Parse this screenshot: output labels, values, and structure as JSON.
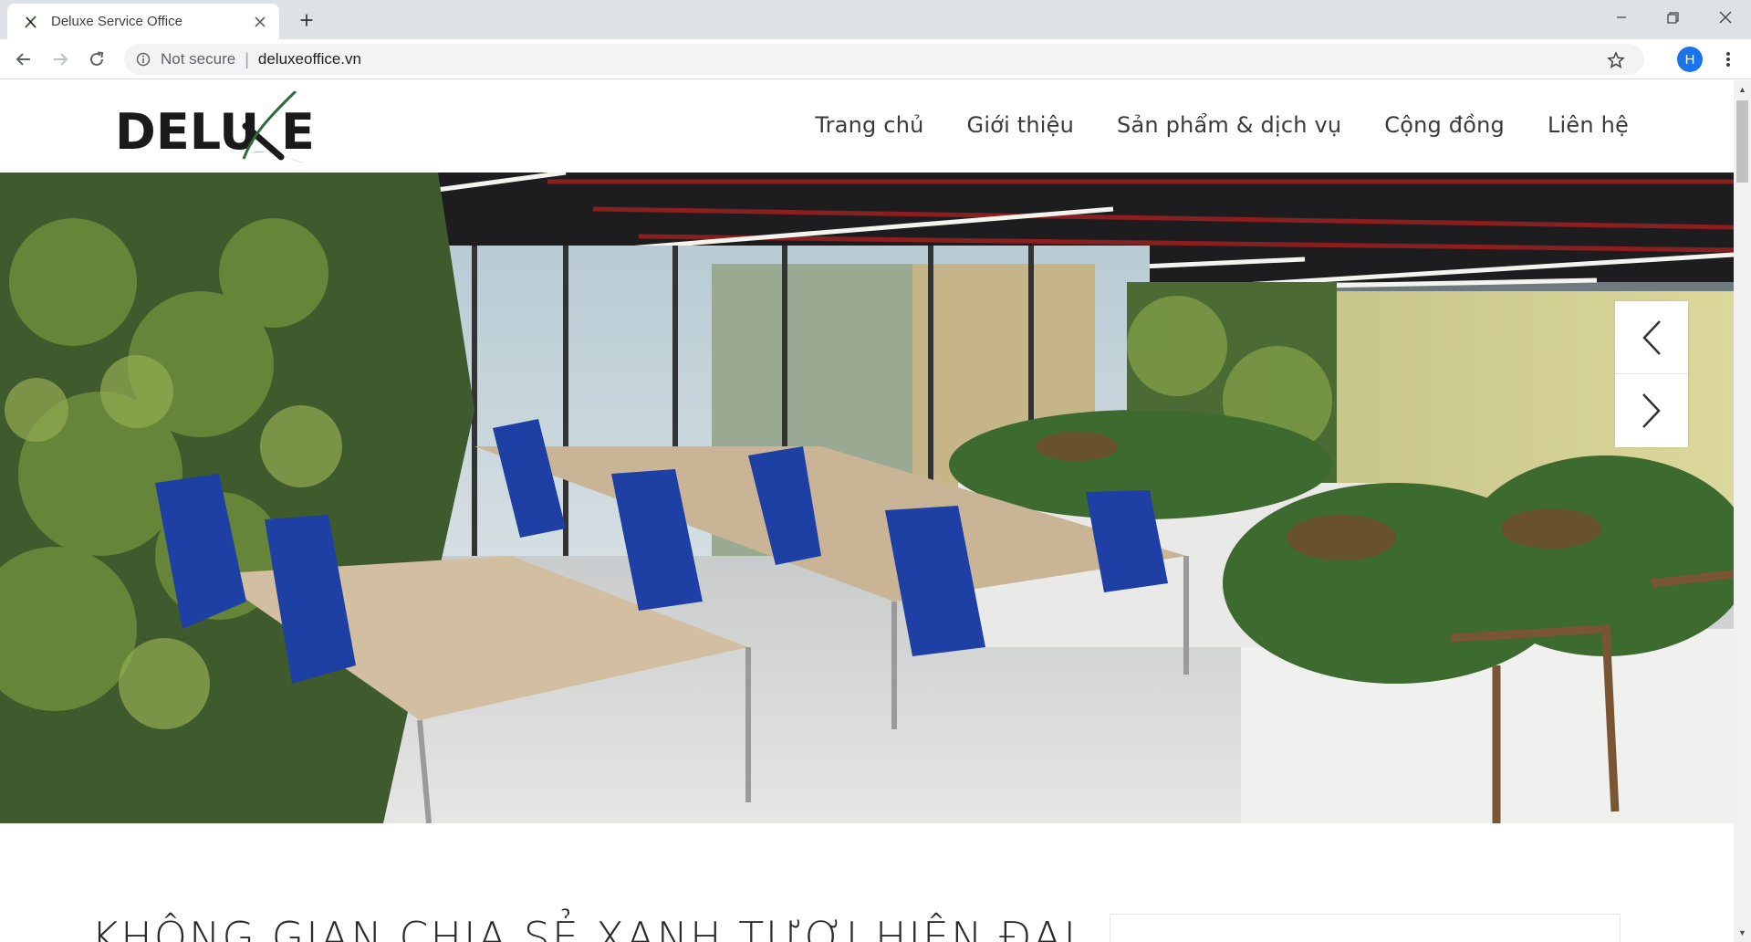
{
  "browser": {
    "tab_title": "Deluxe Service Office",
    "new_tab_symbol": "+",
    "security_label": "Not secure",
    "url": "deluxeoffice.vn",
    "profile_initial": "H"
  },
  "site": {
    "logo_text": "DELU",
    "logo_color": "#1a1a1a",
    "logo_accent_color": "#2f6b3a",
    "nav": [
      {
        "label": "Trang chủ"
      },
      {
        "label": "Giới thiệu"
      },
      {
        "label": "Sản phẩm & dịch vụ"
      },
      {
        "label": "Cộng đồng"
      },
      {
        "label": "Liên hệ"
      }
    ],
    "section_title": "KHÔNG GIAN CHIA SẺ XANH TƯƠI HIỆN ĐẠI"
  },
  "icons": {
    "back": "arrow-left-icon",
    "forward": "arrow-right-icon",
    "reload": "reload-icon",
    "info": "info-icon",
    "star": "star-icon",
    "menu": "kebab-icon",
    "prev": "chevron-left-icon",
    "next": "chevron-right-icon"
  }
}
